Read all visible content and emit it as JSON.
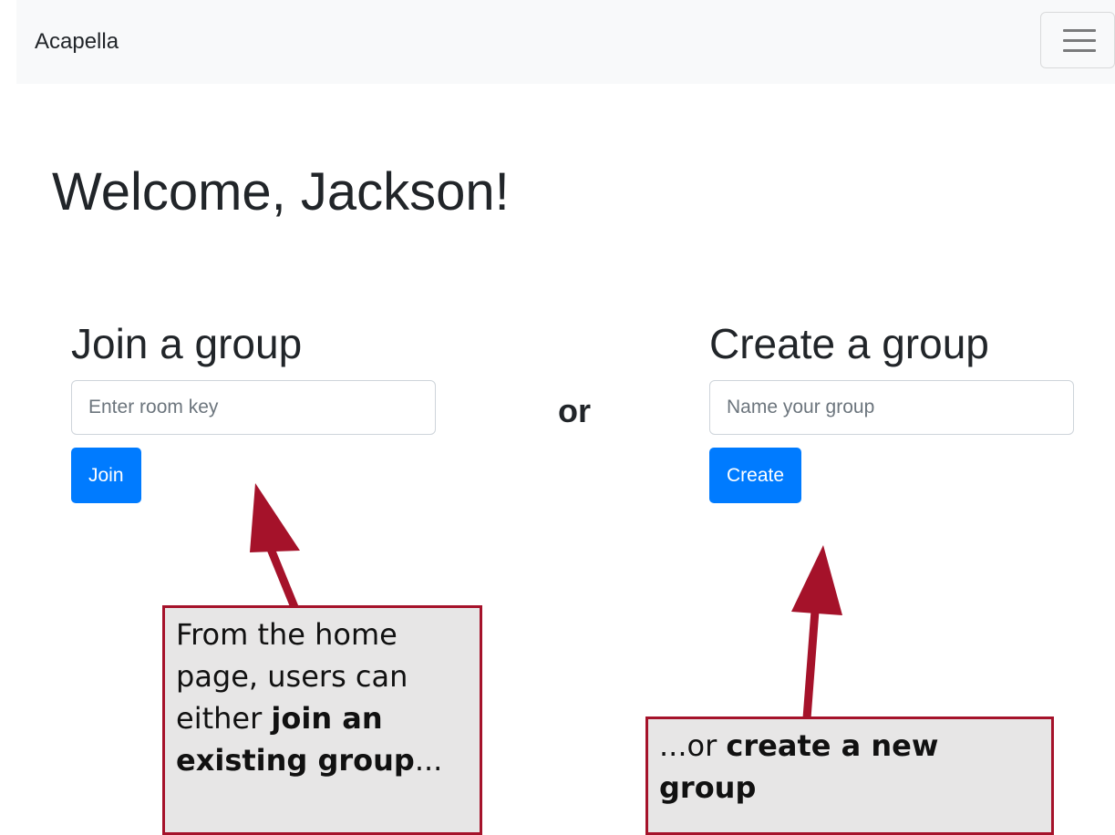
{
  "navbar": {
    "brand": "Acapella"
  },
  "main": {
    "welcome": "Welcome, Jackson!",
    "join": {
      "title": "Join a group",
      "placeholder": "Enter room key",
      "button_label": "Join"
    },
    "separator": "or",
    "create": {
      "title": "Create a group",
      "placeholder": "Name your group",
      "button_label": "Create"
    }
  },
  "annotations": {
    "join_callout": {
      "line1": "From the home",
      "line2": "page, users can",
      "line3_pre": "either ",
      "line3_bold": "join an",
      "line4_bold": "existing group",
      "line4_post": "..."
    },
    "create_callout": {
      "line1_pre": "...or ",
      "line1_bold": "create a new",
      "line2_bold": "group"
    },
    "accent_color": "#a5122a"
  },
  "colors": {
    "primary": "#007bff",
    "navbar_bg": "#f8f9fa",
    "text": "#212529"
  }
}
